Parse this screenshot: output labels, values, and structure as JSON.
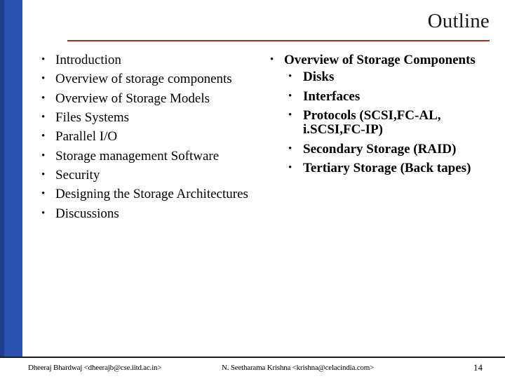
{
  "slide": {
    "title": "Outline",
    "page_number": "14",
    "accent_rule_color": "#a93226",
    "sidebar_color": "#1e3f8f",
    "columns": {
      "left": [
        {
          "bullet": "•",
          "text": "Introduction"
        },
        {
          "bullet": "•",
          "text": "Overview of storage components"
        },
        {
          "bullet": "•",
          "text": "Overview of Storage Models"
        },
        {
          "bullet": "•",
          "text": "Files Systems"
        },
        {
          "bullet": "•",
          "text": "Parallel I/O"
        },
        {
          "bullet": "•",
          "text": "Storage management Software"
        },
        {
          "bullet": "•",
          "text": "Security"
        },
        {
          "bullet": "•",
          "text": "Designing the Storage Architectures"
        },
        {
          "bullet": "•",
          "text": "Discussions"
        }
      ],
      "right": [
        {
          "bullet": "•",
          "text": "Overview of Storage Components",
          "children": [
            {
              "bullet": "•",
              "text": "Disks"
            },
            {
              "bullet": "•",
              "text": "Interfaces"
            },
            {
              "bullet": "•",
              "text": "Protocols (SCSI,FC-AL, i.SCSI,FC-IP)"
            },
            {
              "bullet": "•",
              "text": "Secondary Storage (RAID)"
            },
            {
              "bullet": "•",
              "text": "Tertiary Storage (Back tapes)"
            }
          ]
        }
      ]
    },
    "footer": {
      "left": "Dheeraj Bhardwaj <dheerajb@cse.iitd.ac.in>",
      "center": "N. Seetharama Krishna <krishna@celacindia.com>"
    }
  }
}
